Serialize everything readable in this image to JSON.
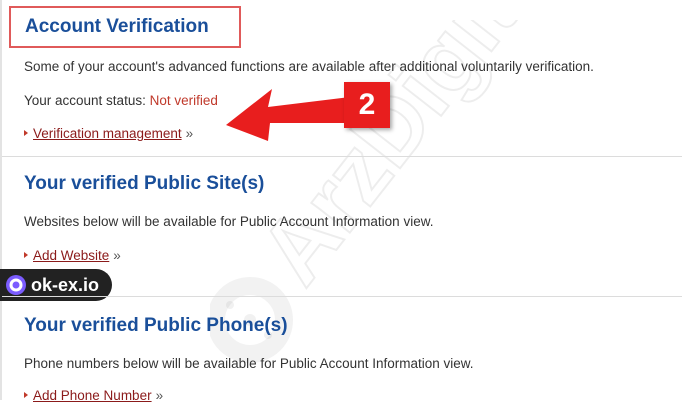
{
  "account_verification": {
    "title": "Account Verification",
    "description": "Some of your account's advanced functions are available after additional voluntarily verification.",
    "status_label": "Your account status:",
    "status_value": "Not verified",
    "link_label": "Verification management",
    "link_suffix": "»"
  },
  "public_sites": {
    "title": "Your verified Public Site(s)",
    "description": "Websites below will be available for Public Account Information view.",
    "link_label": "Add Website",
    "link_suffix": "»"
  },
  "public_phones": {
    "title": "Your verified Public Phone(s)",
    "description": "Phone numbers below will be available for Public Account Information view.",
    "link_label": "Add Phone Number",
    "link_suffix": "»"
  },
  "annotation": {
    "step_number": "2",
    "color": "#e81e1e"
  },
  "overlay_badge": {
    "label": "ok-ex.io",
    "icon": "ok-ex-logo-icon"
  },
  "watermark": {
    "text": "ArzDigital"
  },
  "colors": {
    "heading": "#1a4f9a",
    "link": "#8b1a1a",
    "status_error": "#c0392b",
    "highlight_border": "#e05a5a"
  }
}
